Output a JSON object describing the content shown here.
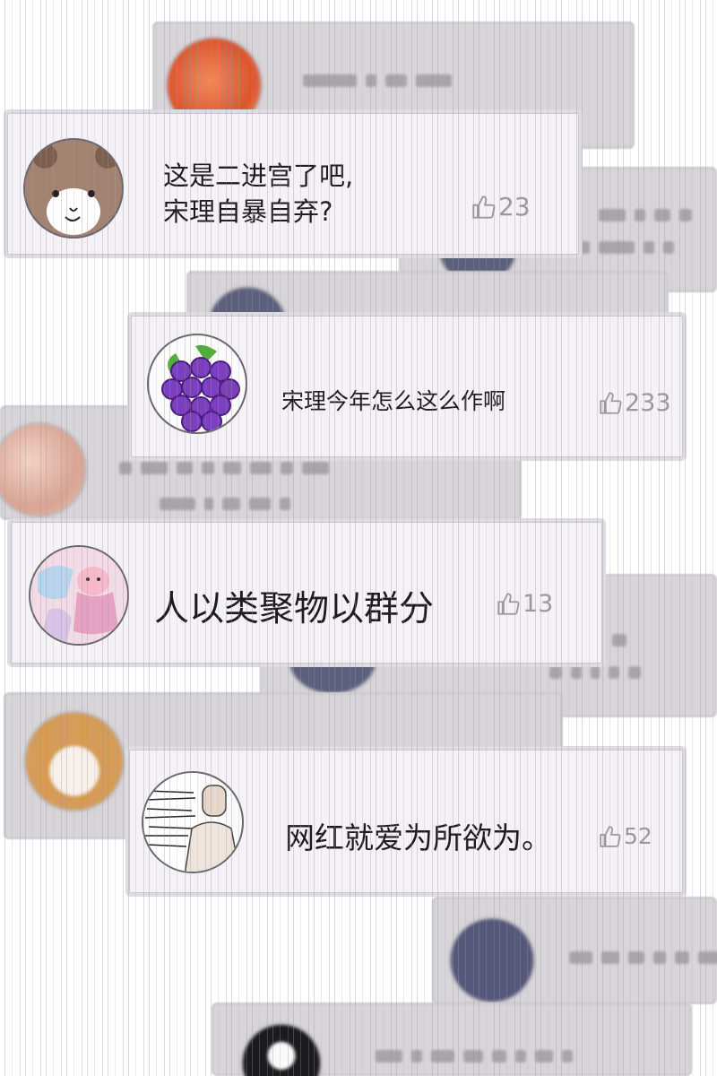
{
  "comments": [
    {
      "text_line1": "这是二进宫了吧,",
      "text_line2": "宋理自暴自弃?",
      "likes": "23",
      "avatar_icon": "bear-avatar-icon"
    },
    {
      "text": "宋理今年怎么这么作啊",
      "likes": "233",
      "avatar_icon": "grape-avatar-icon"
    },
    {
      "text": "人以类聚物以群分",
      "likes": "13",
      "avatar_icon": "anime-girl-bunny-avatar-icon"
    },
    {
      "text": "网红就爱为所欲为。",
      "likes": "52",
      "avatar_icon": "sketch-man-avatar-icon"
    }
  ],
  "icons": {
    "like": "thumbs-up-icon"
  },
  "colors": {
    "card_bg": "#f4f2f5",
    "blur_card_bg": "#d7d5d8",
    "like_gray": "#9a979d"
  }
}
